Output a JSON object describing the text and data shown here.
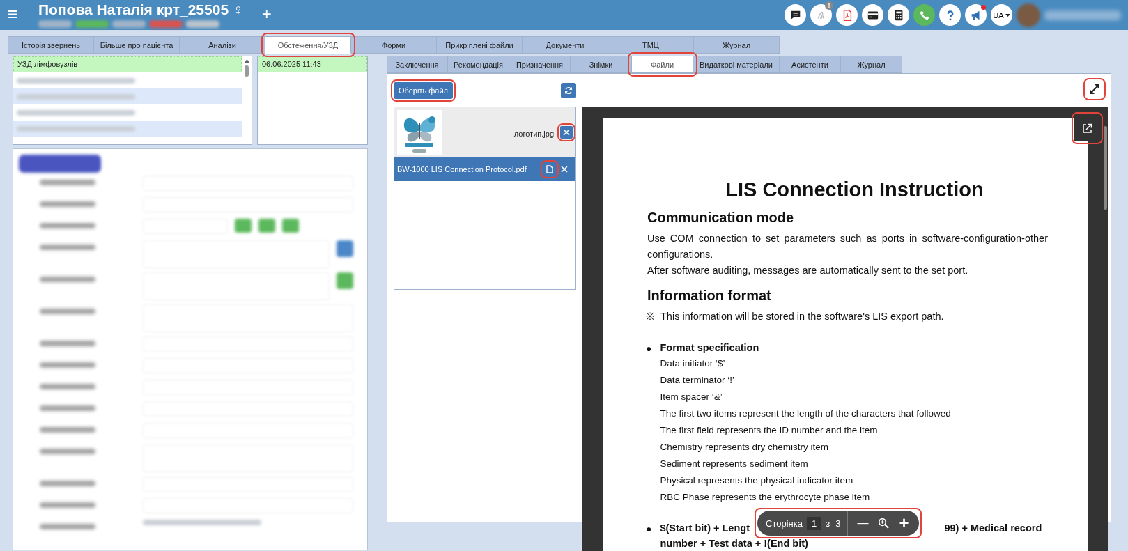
{
  "header": {
    "title": "Попова Наталія крт_25505 ♀",
    "add_label": "+",
    "badges": [
      {
        "color": "#9fb3c8"
      },
      {
        "color": "#5cb85c"
      },
      {
        "color": "#9fb3c8"
      },
      {
        "color": "#d9534f"
      },
      {
        "color": "#b9c3cc"
      }
    ],
    "icons": [
      {
        "kind": "chat"
      },
      {
        "kind": "signature",
        "badge": "!"
      },
      {
        "kind": "pdf"
      },
      {
        "kind": "card"
      },
      {
        "kind": "calculator"
      },
      {
        "kind": "phone"
      },
      {
        "kind": "help"
      },
      {
        "kind": "megaphone",
        "alert": true
      }
    ],
    "language": "UA"
  },
  "main_tabs": [
    {
      "label": "Історія звернень",
      "selected": false
    },
    {
      "label": "Більше про пацієнта",
      "selected": false
    },
    {
      "label": "Аналізи",
      "selected": false
    },
    {
      "label": "Обстеження/УЗД",
      "selected": true,
      "highlighted": true
    },
    {
      "label": "Форми",
      "selected": false
    },
    {
      "label": "Прикріплені файли",
      "selected": false
    },
    {
      "label": "Документи",
      "selected": false
    },
    {
      "label": "ТМЦ",
      "selected": false
    },
    {
      "label": "Журнал",
      "selected": false
    }
  ],
  "procedures": [
    {
      "kind": "text",
      "label": "УЗД лімфовузлів",
      "selected": true,
      "striped": false
    },
    {
      "kind": "blurred",
      "selected": false,
      "striped": false
    },
    {
      "kind": "blurred",
      "selected": false,
      "striped": true
    },
    {
      "kind": "blurred",
      "selected": false,
      "striped": false
    },
    {
      "kind": "blurred",
      "selected": false,
      "striped": true
    }
  ],
  "dates": [
    {
      "label": "06.06.2025 11:43",
      "selected": true
    }
  ],
  "form": {
    "rows": [
      {
        "kind": "select"
      },
      {
        "kind": "select"
      },
      {
        "kind": "chips"
      },
      {
        "kind": "textarea",
        "color": "#4a86c8"
      },
      {
        "kind": "textarea",
        "color": "#5cb85c"
      },
      {
        "kind": "textarea"
      },
      {
        "kind": "input"
      },
      {
        "kind": "input"
      },
      {
        "kind": "input"
      },
      {
        "kind": "input"
      },
      {
        "kind": "select"
      },
      {
        "kind": "textarea"
      },
      {
        "kind": "input"
      },
      {
        "kind": "select"
      },
      {
        "kind": "text"
      }
    ]
  },
  "sub_tabs": [
    {
      "label": "Заключення",
      "selected": false
    },
    {
      "label": "Рекомендація",
      "selected": false
    },
    {
      "label": "Призначення",
      "selected": false
    },
    {
      "label": "Знімки",
      "selected": false
    },
    {
      "label": "Файли",
      "selected": true,
      "highlighted": true
    },
    {
      "label": "Видаткові матеріали",
      "selected": false
    },
    {
      "label": "Асистенти",
      "selected": false
    },
    {
      "label": "Журнал",
      "selected": false
    }
  ],
  "files_panel": {
    "choose_button": {
      "label": "Оберіть файл",
      "highlighted": true
    },
    "files": [
      {
        "name": "логотип.jpg",
        "selected": false,
        "delete_highlighted": true
      },
      {
        "kind": "document",
        "name": "BW-1000 LIS Connection Protocol.pdf",
        "selected": true,
        "open_highlighted": true
      }
    ]
  },
  "viewer": {
    "expand_highlighted": true,
    "popout_highlighted": true,
    "document": [
      {
        "kind": "title",
        "text": "LIS Connection Instruction"
      },
      {
        "kind": "heading",
        "text": "Communication mode"
      },
      {
        "kind": "paragraph",
        "text": "Use COM connection to set parameters such as ports in software-configuration-other configurations."
      },
      {
        "kind": "paragraph",
        "text": "After software auditing, messages are automatically sent to the set port."
      },
      {
        "kind": "heading",
        "text": "Information format"
      },
      {
        "kind": "note",
        "mark": "※",
        "text": "This information will be stored in the software's LIS export path."
      },
      {
        "kind": "bullet",
        "mark": "●",
        "text": "Format specification",
        "lines": [
          "Data initiator ‘$’",
          "Data terminator ‘!’",
          "Item spacer ‘&’",
          "The first two items represent the length of the characters that followed",
          "The first field represents the ID number and the item",
          "Chemistry represents dry chemistry item",
          "Sediment represents sediment item",
          "Physical represents the physical indicator item",
          "RBC Phase represents the erythrocyte phase item"
        ]
      },
      {
        "kind": "bullet_split",
        "mark": "●",
        "parts": [
          "$(Start bit) + Lengt",
          "99) + Medical record"
        ],
        "continuation": "number + Test data + !(End bit)"
      }
    ],
    "toolbar": {
      "page_label": "Сторінка",
      "page": "1",
      "of_label": "з",
      "total": "3",
      "zoom_out": "—",
      "zoom_in": "+",
      "highlighted": true
    }
  }
}
